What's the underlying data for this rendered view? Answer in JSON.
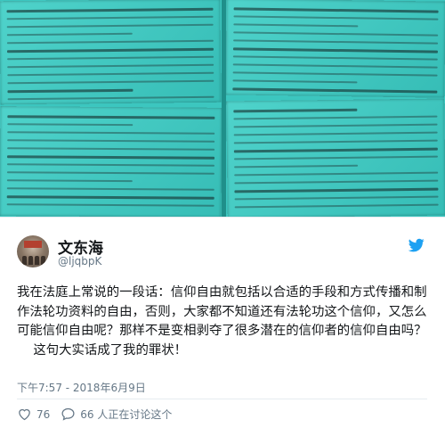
{
  "tweet": {
    "display_name": "文东海",
    "handle": "@ljqbpK",
    "text": "我在法庭上常说的一段话：信仰自由就包括以合适的手段和方式传播和制作法轮功资料的自由，否则，大家都不知道还有法轮功这个信仰，又怎么可能信仰自由呢？那样不是变相剥夺了很多潜在的信仰者的信仰自由吗？\n    这句大实话成了我的罪状！",
    "timestamp": "下午7:57 - 2018年6月9日",
    "likes": "76",
    "talking": "66 人正在讨论这个"
  },
  "icons": {
    "brand": "twitter-bird-icon",
    "like": "heart-icon",
    "reply": "speech-bubble-icon"
  },
  "colors": {
    "brand": "#1da1f2",
    "photo_paper": "#3cc6bf",
    "muted": "#657786",
    "text": "#14171a"
  }
}
